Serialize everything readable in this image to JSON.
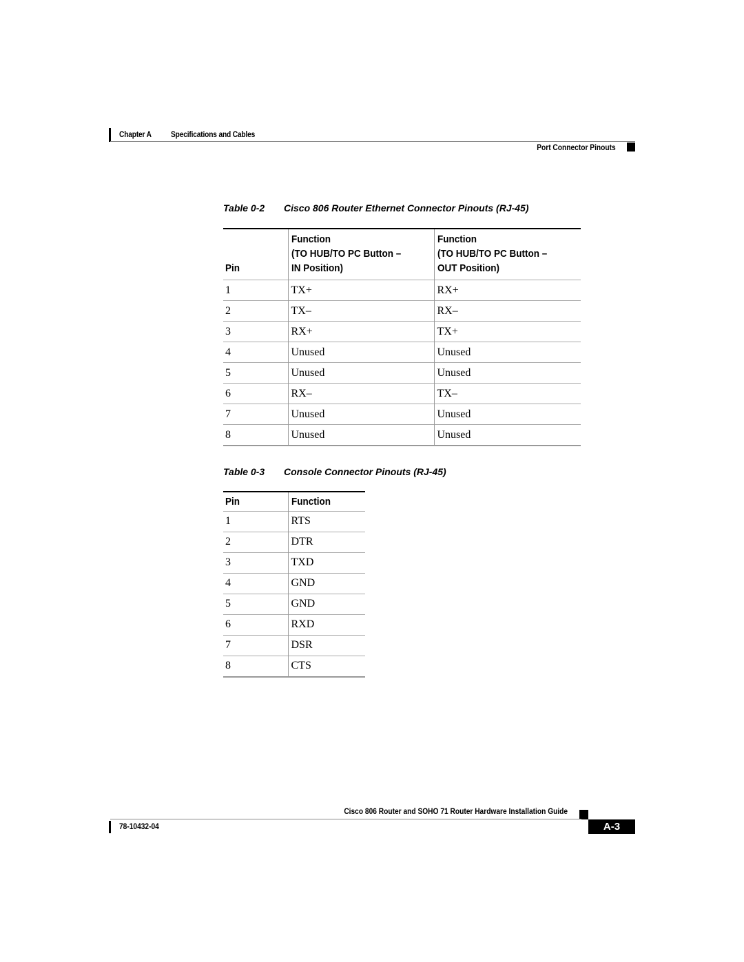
{
  "header": {
    "chapter": "Chapter A",
    "section": "Specifications and Cables",
    "subsection": "Port Connector Pinouts"
  },
  "ethernet_table": {
    "caption_number": "Table 0-2",
    "caption_title": "Cisco 806 Router Ethernet Connector Pinouts (RJ-45)",
    "headers": {
      "pin": "Pin",
      "in_line1": "Function",
      "in_line2": "(TO HUB/TO PC Button –",
      "in_line3": "IN Position)",
      "out_line1": "Function",
      "out_line2": "(TO HUB/TO PC Button –",
      "out_line3": "OUT Position)"
    },
    "rows": [
      {
        "pin": "1",
        "in": "TX+",
        "out": "RX+"
      },
      {
        "pin": "2",
        "in": "TX–",
        "out": "RX–"
      },
      {
        "pin": "3",
        "in": "RX+",
        "out": "TX+"
      },
      {
        "pin": "4",
        "in": "Unused",
        "out": "Unused"
      },
      {
        "pin": "5",
        "in": "Unused",
        "out": "Unused"
      },
      {
        "pin": "6",
        "in": "RX–",
        "out": "TX–"
      },
      {
        "pin": "7",
        "in": "Unused",
        "out": "Unused"
      },
      {
        "pin": "8",
        "in": "Unused",
        "out": "Unused"
      }
    ]
  },
  "console_table": {
    "caption_number": "Table 0-3",
    "caption_title": "Console Connector Pinouts (RJ-45)",
    "headers": {
      "pin": "Pin",
      "function": "Function"
    },
    "rows": [
      {
        "pin": "1",
        "function": "RTS"
      },
      {
        "pin": "2",
        "function": "DTR"
      },
      {
        "pin": "3",
        "function": "TXD"
      },
      {
        "pin": "4",
        "function": "GND"
      },
      {
        "pin": "5",
        "function": "GND"
      },
      {
        "pin": "6",
        "function": "RXD"
      },
      {
        "pin": "7",
        "function": "DSR"
      },
      {
        "pin": "8",
        "function": "CTS"
      }
    ]
  },
  "footer": {
    "guide_title": "Cisco 806 Router and SOHO 71 Router Hardware Installation Guide",
    "doc_number": "78-10432-04",
    "page_number": "A-3"
  }
}
